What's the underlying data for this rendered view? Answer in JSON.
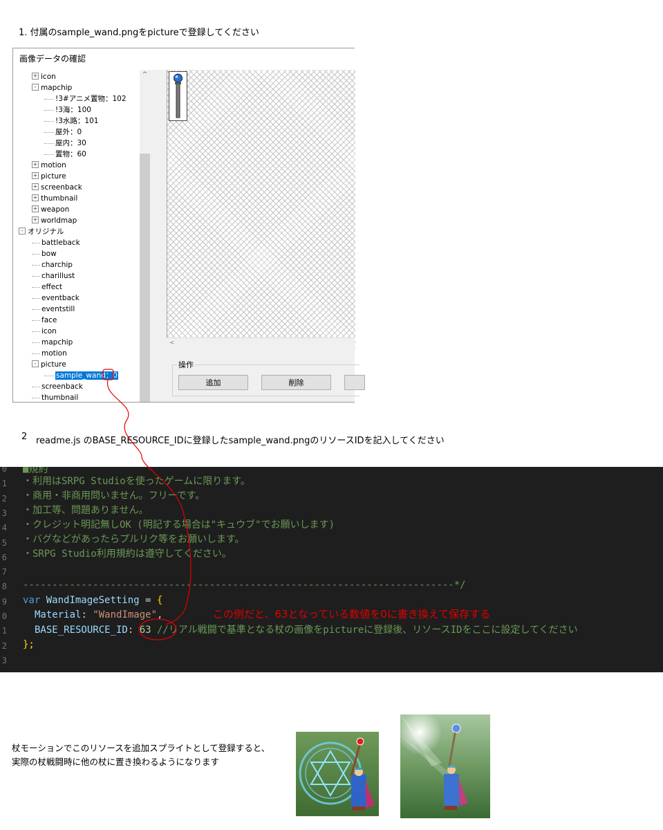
{
  "step1": {
    "title": "1. 付属のsample_wand.pngをpictureで登録してください"
  },
  "window": {
    "title": "画像データの確認",
    "tree": [
      {
        "label": "icon",
        "indent": 1,
        "expander": "+"
      },
      {
        "label": "mapchip",
        "indent": 1,
        "expander": "-"
      },
      {
        "label": "!3#アニメ置物：102",
        "indent": 2,
        "expander": ""
      },
      {
        "label": "!3海：100",
        "indent": 2,
        "expander": ""
      },
      {
        "label": "!3水路：101",
        "indent": 2,
        "expander": ""
      },
      {
        "label": "屋外：0",
        "indent": 2,
        "expander": ""
      },
      {
        "label": "屋内：30",
        "indent": 2,
        "expander": ""
      },
      {
        "label": "置物：60",
        "indent": 2,
        "expander": ""
      },
      {
        "label": "motion",
        "indent": 1,
        "expander": "+"
      },
      {
        "label": "picture",
        "indent": 1,
        "expander": "+"
      },
      {
        "label": "screenback",
        "indent": 1,
        "expander": "+"
      },
      {
        "label": "thumbnail",
        "indent": 1,
        "expander": "+"
      },
      {
        "label": "weapon",
        "indent": 1,
        "expander": "+"
      },
      {
        "label": "worldmap",
        "indent": 1,
        "expander": "+"
      },
      {
        "label": "オリジナル",
        "indent": 0,
        "expander": "-"
      },
      {
        "label": "battleback",
        "indent": 1,
        "expander": ""
      },
      {
        "label": "bow",
        "indent": 1,
        "expander": ""
      },
      {
        "label": "charchip",
        "indent": 1,
        "expander": ""
      },
      {
        "label": "charillust",
        "indent": 1,
        "expander": ""
      },
      {
        "label": "effect",
        "indent": 1,
        "expander": ""
      },
      {
        "label": "eventback",
        "indent": 1,
        "expander": ""
      },
      {
        "label": "eventstill",
        "indent": 1,
        "expander": ""
      },
      {
        "label": "face",
        "indent": 1,
        "expander": ""
      },
      {
        "label": "icon",
        "indent": 1,
        "expander": ""
      },
      {
        "label": "mapchip",
        "indent": 1,
        "expander": ""
      },
      {
        "label": "motion",
        "indent": 1,
        "expander": ""
      },
      {
        "label": "picture",
        "indent": 1,
        "expander": "-"
      },
      {
        "label": "sample_wand：0",
        "indent": 2,
        "expander": "",
        "selected": true
      },
      {
        "label": "screenback",
        "indent": 1,
        "expander": ""
      },
      {
        "label": "thumbnail",
        "indent": 1,
        "expander": ""
      }
    ],
    "scroll_left_glyph": "<",
    "scroll_up_glyph": "^",
    "operations": {
      "label": "操作",
      "add": "追加",
      "delete": "削除"
    }
  },
  "step2": {
    "num": "2",
    "title": "readme.js のBASE_RESOURCE_IDに登録したsample_wand.pngのリソースIDを記入してください"
  },
  "code": {
    "line_numbers": [
      "0",
      "1",
      "2",
      "3",
      "4",
      "5",
      "6",
      "7",
      "8",
      "9",
      "0",
      "1",
      "2",
      "3"
    ],
    "l0": "■規約",
    "l1": "・利用はSRPG Studioを使ったゲームに限ります。",
    "l2": "・商用・非商用問いません。フリーです。",
    "l3": "・加工等、問題ありません。",
    "l4": "・クレジット明記無しOK (明記する場合は\"キュウブ\"でお願いします)",
    "l5": "・バグなどがあったらプルリク等をお願いします。",
    "l6": "・SRPG Studio利用規約は遵守してください。",
    "l8": "--------------------------------------------------------------------------*/",
    "kw_var": "var",
    "obj_name": "WandImageSetting",
    "eq": " = ",
    "brace_open": "{",
    "prop_material": "Material",
    "colon": ": ",
    "material_value": "\"WandImage\"",
    "comma": ",",
    "prop_base": "BASE_RESOURCE_ID",
    "base_value": "63",
    "base_comment": " //リアル戦闘で基準となる杖の画像をpictureに登録後、リソースIDをここに設定してください",
    "brace_close": "};",
    "note": "この例だと、63となっている数値を0に書き換えて保存する"
  },
  "desc": {
    "line1": "杖モーションでこのリソースを追加スプライトとして登録すると、",
    "line2": "実際の杖戦闘時に他の杖に置き換わるようになります"
  },
  "colors": {
    "annotation_red": "#e00000",
    "selection_blue": "#0078d7",
    "editor_bg": "#1e1e1e"
  }
}
